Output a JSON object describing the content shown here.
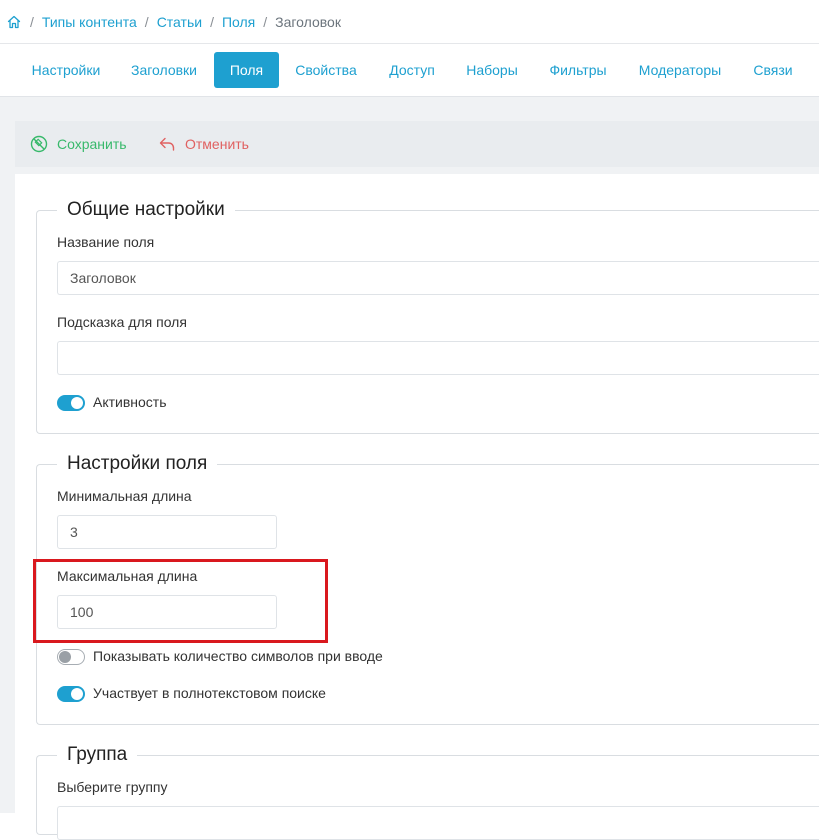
{
  "breadcrumb": {
    "items": [
      "Типы контента",
      "Статьи",
      "Поля"
    ],
    "current": "Заголовок",
    "separator": "/"
  },
  "tabs": [
    {
      "label": "Настройки",
      "active": false
    },
    {
      "label": "Заголовки",
      "active": false
    },
    {
      "label": "Поля",
      "active": true
    },
    {
      "label": "Свойства",
      "active": false
    },
    {
      "label": "Доступ",
      "active": false
    },
    {
      "label": "Наборы",
      "active": false
    },
    {
      "label": "Фильтры",
      "active": false
    },
    {
      "label": "Модераторы",
      "active": false
    },
    {
      "label": "Связи",
      "active": false
    }
  ],
  "toolbar": {
    "save_label": "Сохранить",
    "cancel_label": "Отменить"
  },
  "general": {
    "legend": "Общие настройки",
    "name_label": "Название поля",
    "name_value": "Заголовок",
    "hint_label": "Подсказка для поля",
    "hint_value": "",
    "active_label": "Активность",
    "active_on": true
  },
  "field_settings": {
    "legend": "Настройки поля",
    "min_label": "Минимальная длина",
    "min_value": "3",
    "max_label": "Максимальная длина",
    "max_value": "100",
    "show_count_label": "Показывать количество символов при вводе",
    "show_count_on": false,
    "fulltext_label": "Участвует в полнотекстовом поиске",
    "fulltext_on": true
  },
  "group": {
    "legend": "Группа",
    "select_label": "Выберите группу"
  },
  "colors": {
    "accent": "#1ea0d0",
    "save": "#38b96b",
    "cancel": "#e06161",
    "highlight": "#d9181e"
  }
}
